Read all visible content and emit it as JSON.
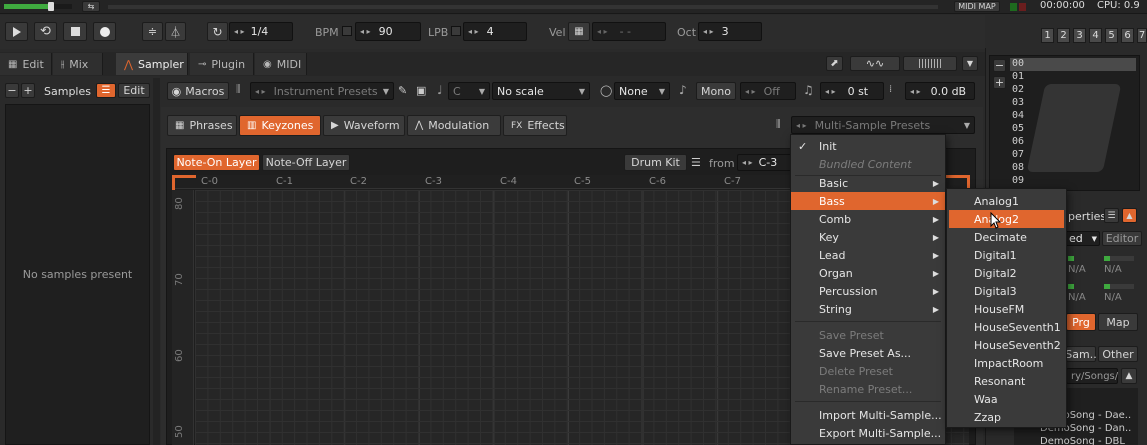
{
  "topbar": {
    "midi_map": "MIDI MAP",
    "time": "00:00:00",
    "cpu": "CPU: 0.9"
  },
  "transport": {
    "edit_step": "1/4",
    "bpm_label": "BPM",
    "bpm_value": "90",
    "lpb_label": "LPB",
    "lpb_value": "4",
    "vel_label": "Vel",
    "vel_value": "- -",
    "oct_label": "Oct",
    "oct_value": "3",
    "track_numbers": [
      "1",
      "2",
      "3",
      "4",
      "5",
      "6",
      "7"
    ]
  },
  "tabs": [
    {
      "label": "Edit"
    },
    {
      "label": "Mix"
    },
    {
      "label": "Sampler"
    },
    {
      "label": "Plugin"
    },
    {
      "label": "MIDI"
    }
  ],
  "samples_panel": {
    "title": "Samples",
    "edit": "Edit",
    "empty_text": "No samples present"
  },
  "instrument_bar": {
    "macros": "Macros",
    "presets": "Instrument Presets",
    "key": "C",
    "scale": "No scale",
    "chord": "None",
    "mono": "Mono",
    "glide": "Off",
    "transpose": "0 st",
    "volume": "0.0 dB"
  },
  "subtabs": [
    {
      "label": "Phrases"
    },
    {
      "label": "Keyzones"
    },
    {
      "label": "Waveform"
    },
    {
      "label": "Modulation"
    },
    {
      "label": "Effects"
    }
  ],
  "multi_sample_presets": "Multi-Sample Presets",
  "keyzone_bar": {
    "note_on": "Note-On Layer",
    "note_off": "Note-Off Layer",
    "drum_kit": "Drum Kit",
    "from_label": "from",
    "from_value": "C-3"
  },
  "keyboard_labels": [
    "C-0",
    "C-1",
    "C-2",
    "C-3",
    "C-4",
    "C-5",
    "C-6",
    "C-7"
  ],
  "velocity_labels": [
    "80",
    "70",
    "60",
    "50"
  ],
  "preset_menu": {
    "items": [
      {
        "label": "Init",
        "checked": true
      },
      {
        "label": "Bundled Content",
        "header": true
      },
      {
        "label": "Basic",
        "sub": true
      },
      {
        "label": "Bass",
        "sub": true,
        "highlight": true
      },
      {
        "label": "Comb",
        "sub": true
      },
      {
        "label": "Key",
        "sub": true
      },
      {
        "label": "Lead",
        "sub": true
      },
      {
        "label": "Organ",
        "sub": true
      },
      {
        "label": "Percussion",
        "sub": true
      },
      {
        "label": "String",
        "sub": true
      },
      {
        "label": "Save Preset",
        "disabled": true
      },
      {
        "label": "Save Preset As..."
      },
      {
        "label": "Delete Preset",
        "disabled": true
      },
      {
        "label": "Rename Preset...",
        "disabled": true
      },
      {
        "label": "Import Multi-Sample..."
      },
      {
        "label": "Export Multi-Sample..."
      }
    ]
  },
  "bass_submenu": {
    "items": [
      "Analog1",
      "Analog2",
      "Decimate",
      "Digital1",
      "Digital2",
      "Digital3",
      "HouseFM",
      "HouseSeventh1",
      "HouseSeventh2",
      "ImpactRoom",
      "Resonant",
      "Waa",
      "Zzap"
    ],
    "highlight_index": 1
  },
  "right_panel": {
    "program_numbers": [
      "00",
      "01",
      "02",
      "03",
      "04",
      "05",
      "06",
      "07",
      "08",
      "09"
    ],
    "properties": "perties",
    "mode": "ed",
    "editor": "Editor",
    "na": "N/A",
    "prg": "Prg",
    "map": "Map",
    "sam": "Sam..",
    "other": "Other",
    "path": "ry/Songs/",
    "songs": [
      "DemoSong - Dae..",
      "DemoSong - Dan..",
      "DemoSong - DBL"
    ]
  }
}
